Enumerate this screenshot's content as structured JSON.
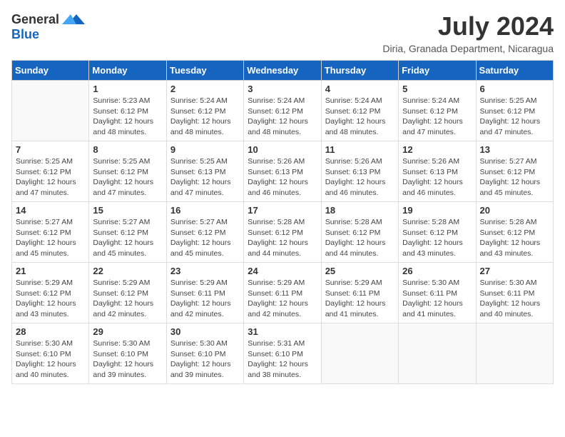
{
  "logo": {
    "general": "General",
    "blue": "Blue"
  },
  "title": {
    "month_year": "July 2024",
    "location": "Diria, Granada Department, Nicaragua"
  },
  "headers": [
    "Sunday",
    "Monday",
    "Tuesday",
    "Wednesday",
    "Thursday",
    "Friday",
    "Saturday"
  ],
  "weeks": [
    [
      {
        "day": "",
        "info": ""
      },
      {
        "day": "1",
        "info": "Sunrise: 5:23 AM\nSunset: 6:12 PM\nDaylight: 12 hours\nand 48 minutes."
      },
      {
        "day": "2",
        "info": "Sunrise: 5:24 AM\nSunset: 6:12 PM\nDaylight: 12 hours\nand 48 minutes."
      },
      {
        "day": "3",
        "info": "Sunrise: 5:24 AM\nSunset: 6:12 PM\nDaylight: 12 hours\nand 48 minutes."
      },
      {
        "day": "4",
        "info": "Sunrise: 5:24 AM\nSunset: 6:12 PM\nDaylight: 12 hours\nand 48 minutes."
      },
      {
        "day": "5",
        "info": "Sunrise: 5:24 AM\nSunset: 6:12 PM\nDaylight: 12 hours\nand 47 minutes."
      },
      {
        "day": "6",
        "info": "Sunrise: 5:25 AM\nSunset: 6:12 PM\nDaylight: 12 hours\nand 47 minutes."
      }
    ],
    [
      {
        "day": "7",
        "info": "Sunrise: 5:25 AM\nSunset: 6:12 PM\nDaylight: 12 hours\nand 47 minutes."
      },
      {
        "day": "8",
        "info": "Sunrise: 5:25 AM\nSunset: 6:12 PM\nDaylight: 12 hours\nand 47 minutes."
      },
      {
        "day": "9",
        "info": "Sunrise: 5:25 AM\nSunset: 6:13 PM\nDaylight: 12 hours\nand 47 minutes."
      },
      {
        "day": "10",
        "info": "Sunrise: 5:26 AM\nSunset: 6:13 PM\nDaylight: 12 hours\nand 46 minutes."
      },
      {
        "day": "11",
        "info": "Sunrise: 5:26 AM\nSunset: 6:13 PM\nDaylight: 12 hours\nand 46 minutes."
      },
      {
        "day": "12",
        "info": "Sunrise: 5:26 AM\nSunset: 6:13 PM\nDaylight: 12 hours\nand 46 minutes."
      },
      {
        "day": "13",
        "info": "Sunrise: 5:27 AM\nSunset: 6:12 PM\nDaylight: 12 hours\nand 45 minutes."
      }
    ],
    [
      {
        "day": "14",
        "info": "Sunrise: 5:27 AM\nSunset: 6:12 PM\nDaylight: 12 hours\nand 45 minutes."
      },
      {
        "day": "15",
        "info": "Sunrise: 5:27 AM\nSunset: 6:12 PM\nDaylight: 12 hours\nand 45 minutes."
      },
      {
        "day": "16",
        "info": "Sunrise: 5:27 AM\nSunset: 6:12 PM\nDaylight: 12 hours\nand 45 minutes."
      },
      {
        "day": "17",
        "info": "Sunrise: 5:28 AM\nSunset: 6:12 PM\nDaylight: 12 hours\nand 44 minutes."
      },
      {
        "day": "18",
        "info": "Sunrise: 5:28 AM\nSunset: 6:12 PM\nDaylight: 12 hours\nand 44 minutes."
      },
      {
        "day": "19",
        "info": "Sunrise: 5:28 AM\nSunset: 6:12 PM\nDaylight: 12 hours\nand 43 minutes."
      },
      {
        "day": "20",
        "info": "Sunrise: 5:28 AM\nSunset: 6:12 PM\nDaylight: 12 hours\nand 43 minutes."
      }
    ],
    [
      {
        "day": "21",
        "info": "Sunrise: 5:29 AM\nSunset: 6:12 PM\nDaylight: 12 hours\nand 43 minutes."
      },
      {
        "day": "22",
        "info": "Sunrise: 5:29 AM\nSunset: 6:12 PM\nDaylight: 12 hours\nand 42 minutes."
      },
      {
        "day": "23",
        "info": "Sunrise: 5:29 AM\nSunset: 6:11 PM\nDaylight: 12 hours\nand 42 minutes."
      },
      {
        "day": "24",
        "info": "Sunrise: 5:29 AM\nSunset: 6:11 PM\nDaylight: 12 hours\nand 42 minutes."
      },
      {
        "day": "25",
        "info": "Sunrise: 5:29 AM\nSunset: 6:11 PM\nDaylight: 12 hours\nand 41 minutes."
      },
      {
        "day": "26",
        "info": "Sunrise: 5:30 AM\nSunset: 6:11 PM\nDaylight: 12 hours\nand 41 minutes."
      },
      {
        "day": "27",
        "info": "Sunrise: 5:30 AM\nSunset: 6:11 PM\nDaylight: 12 hours\nand 40 minutes."
      }
    ],
    [
      {
        "day": "28",
        "info": "Sunrise: 5:30 AM\nSunset: 6:10 PM\nDaylight: 12 hours\nand 40 minutes."
      },
      {
        "day": "29",
        "info": "Sunrise: 5:30 AM\nSunset: 6:10 PM\nDaylight: 12 hours\nand 39 minutes."
      },
      {
        "day": "30",
        "info": "Sunrise: 5:30 AM\nSunset: 6:10 PM\nDaylight: 12 hours\nand 39 minutes."
      },
      {
        "day": "31",
        "info": "Sunrise: 5:31 AM\nSunset: 6:10 PM\nDaylight: 12 hours\nand 38 minutes."
      },
      {
        "day": "",
        "info": ""
      },
      {
        "day": "",
        "info": ""
      },
      {
        "day": "",
        "info": ""
      }
    ]
  ]
}
